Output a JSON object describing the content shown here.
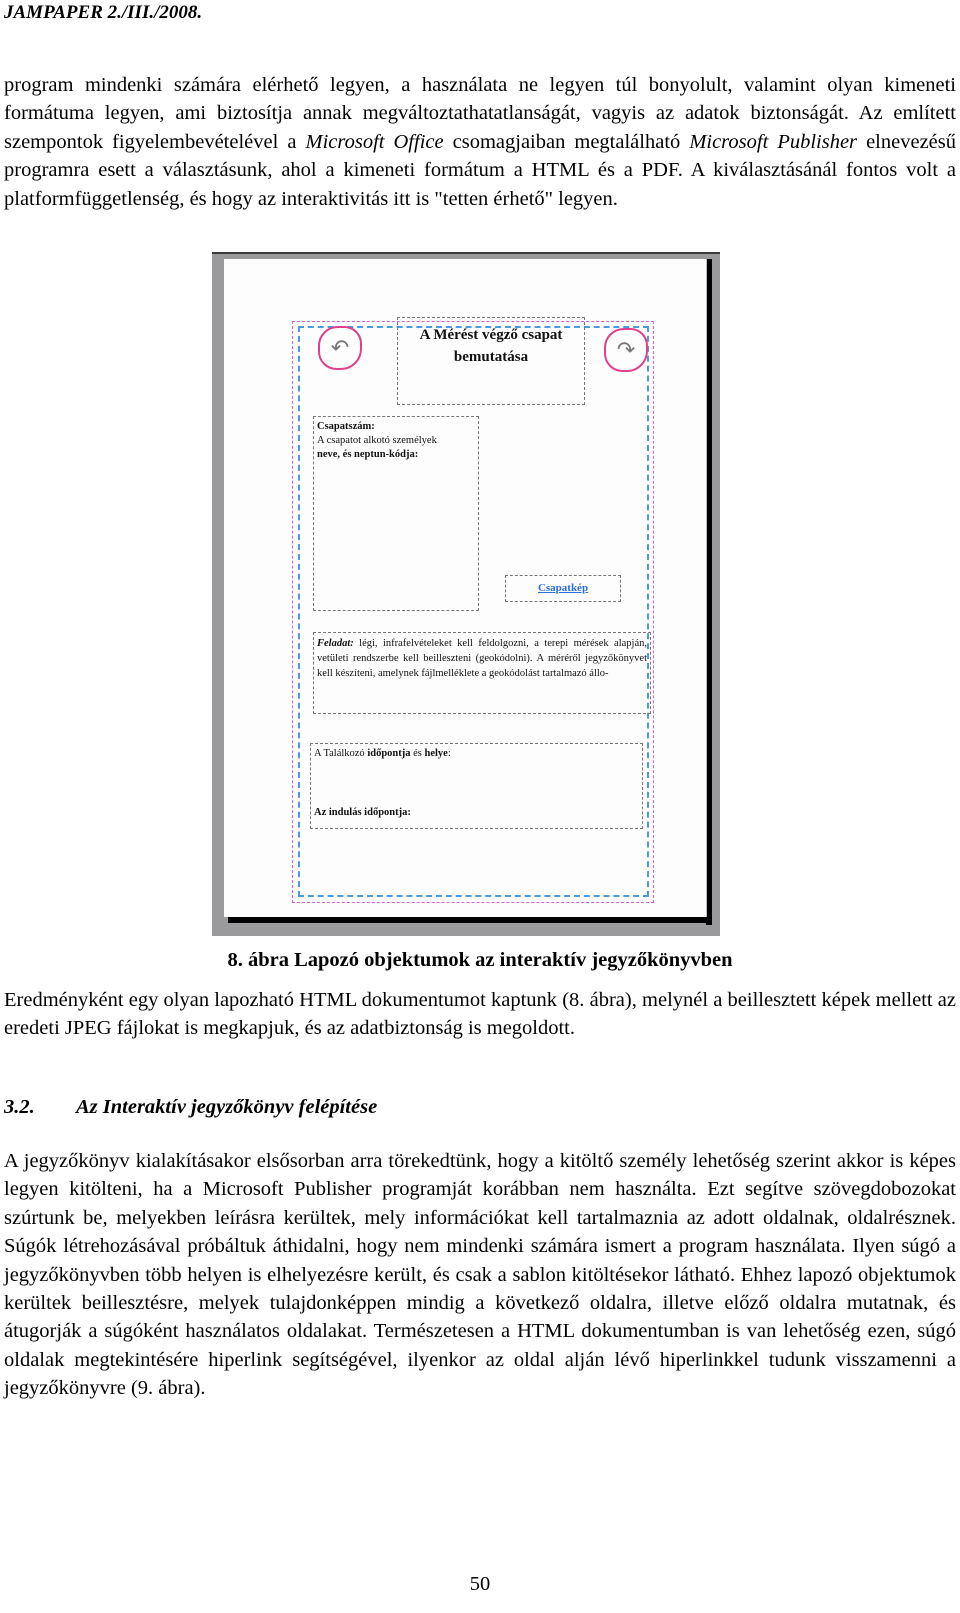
{
  "header": {
    "journal": "JAMPAPER 2./III./2008."
  },
  "paragraph_1": {
    "t1": "program mindenki számára elérhető legyen, a használata ne legyen túl bonyolult, valamint olyan kimeneti formátuma legyen, ami biztosítja annak megváltoztathatatlanságát, vagyis az adatok biztonságát. Az említett szempontok figyelembevételével a ",
    "i1": "Microsoft Office",
    "t2": " csomagjaiban megtalálható ",
    "i2": "Microsoft Publisher",
    "t3": " elnevezésű programra esett a választásunk, ahol a kimeneti formátum a HTML és a PDF. A kiválasztásánál fontos volt a platformfüggetlenség, és hogy az interaktivitás itt is \"tetten érhető\" legyen."
  },
  "figure": {
    "title_box": "A Mérést végző csapat bemutatása",
    "team_label": "Csapatszám:",
    "team_desc_1": "A csapatot alkotó személyek",
    "team_desc_2": "neve, és neptun-kódja:",
    "photo_link": "Csapatkép",
    "task_label": "Feladat:",
    "task_text": " légi, infrafelvételeket kell feldolgozni, a terepi mérések alapján, vetületi rendszerbe kell beilleszteni (geokódolni). A méréről jegyzőkönyvet kell készíteni, amelynek fájlmelléklete a geokódolást tartalmazó állo-",
    "meet_prefix": "A Találkozó ",
    "meet_bold": "időpontja",
    "meet_mid": " és ",
    "meet_bold2": "helye",
    "meet_suffix": ":",
    "departure": "Az indulás időpontja:",
    "prev_icon": "↶",
    "next_icon": "↷"
  },
  "caption": "8. ábra Lapozó objektumok az interaktív jegyzőkönyvben",
  "paragraph_2": "Eredményként egy olyan lapozható HTML dokumentumot kaptunk (8. ábra), melynél a beillesztett képek mellett az eredeti JPEG fájlokat is megkapjuk, és az adatbiztonság is megoldott.",
  "section": {
    "number": "3.2.",
    "title": "Az Interaktív jegyzőkönyv felépítése"
  },
  "paragraph_3": "A jegyzőkönyv kialakításakor elsősorban arra törekedtünk, hogy a kitöltő személy lehetőség szerint akkor is képes legyen kitölteni, ha a Microsoft Publisher programját korábban nem használta. Ezt segítve szövegdobozokat szúrtunk be, melyekben leírásra kerültek, mely információkat kell tartalmaznia az adott oldalnak, oldalrésznek. Súgók létrehozásával próbáltuk áthidalni, hogy nem mindenki számára ismert a program használata. Ilyen súgó a jegyzőkönyvben több helyen is elhelyezésre került, és csak a sablon kitöltésekor látható. Ehhez lapozó objektumok kerültek beillesztésre, melyek tulajdonképpen mindig a következő oldalra, illetve előző oldalra mutatnak, és átugorják a súgóként használatos oldalakat. Természetesen a HTML dokumentumban is van lehetőség ezen, súgó oldalak megtekintésére hiperlink segítségével, ilyenkor az oldal alján lévő hiperlinkkel tudunk visszamenni a jegyzőkönyvre (9. ábra).",
  "page_number": "50"
}
